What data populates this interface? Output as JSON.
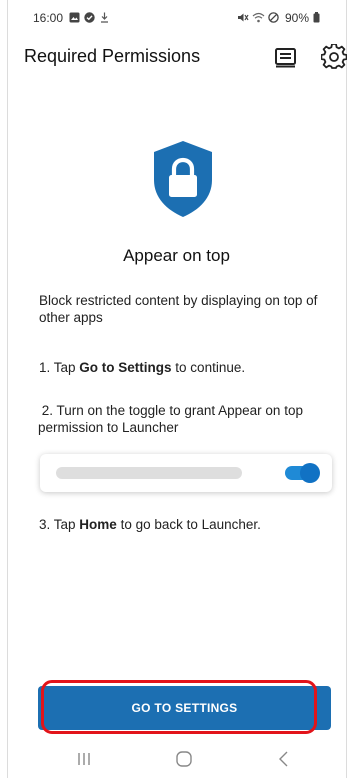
{
  "status_bar": {
    "time": "16:00",
    "battery_text": "90%"
  },
  "header": {
    "title": "Required Permissions",
    "icons": [
      "guide-icon",
      "settings-gear-icon"
    ]
  },
  "main": {
    "shield_icon": "lock-shield-icon",
    "title": "Appear on top",
    "description": "Block restricted content by displaying on top of other apps",
    "step1": {
      "prefix": "1. Tap ",
      "bold": "Go to Settings",
      "suffix": " to continue."
    },
    "step2": " 2. Turn on the toggle to grant Appear on top permission to Launcher",
    "toggle_on": true,
    "step3": {
      "prefix": "3. Tap ",
      "bold": "Home",
      "suffix": " to go back to Launcher."
    }
  },
  "cta": {
    "label": "GO TO SETTINGS"
  },
  "nav": {
    "items": [
      "recent-apps-icon",
      "home-icon",
      "back-icon"
    ]
  },
  "colors": {
    "primary": "#1c6fb2",
    "toggle": "#1f8ad6",
    "highlight": "#e2141a"
  }
}
